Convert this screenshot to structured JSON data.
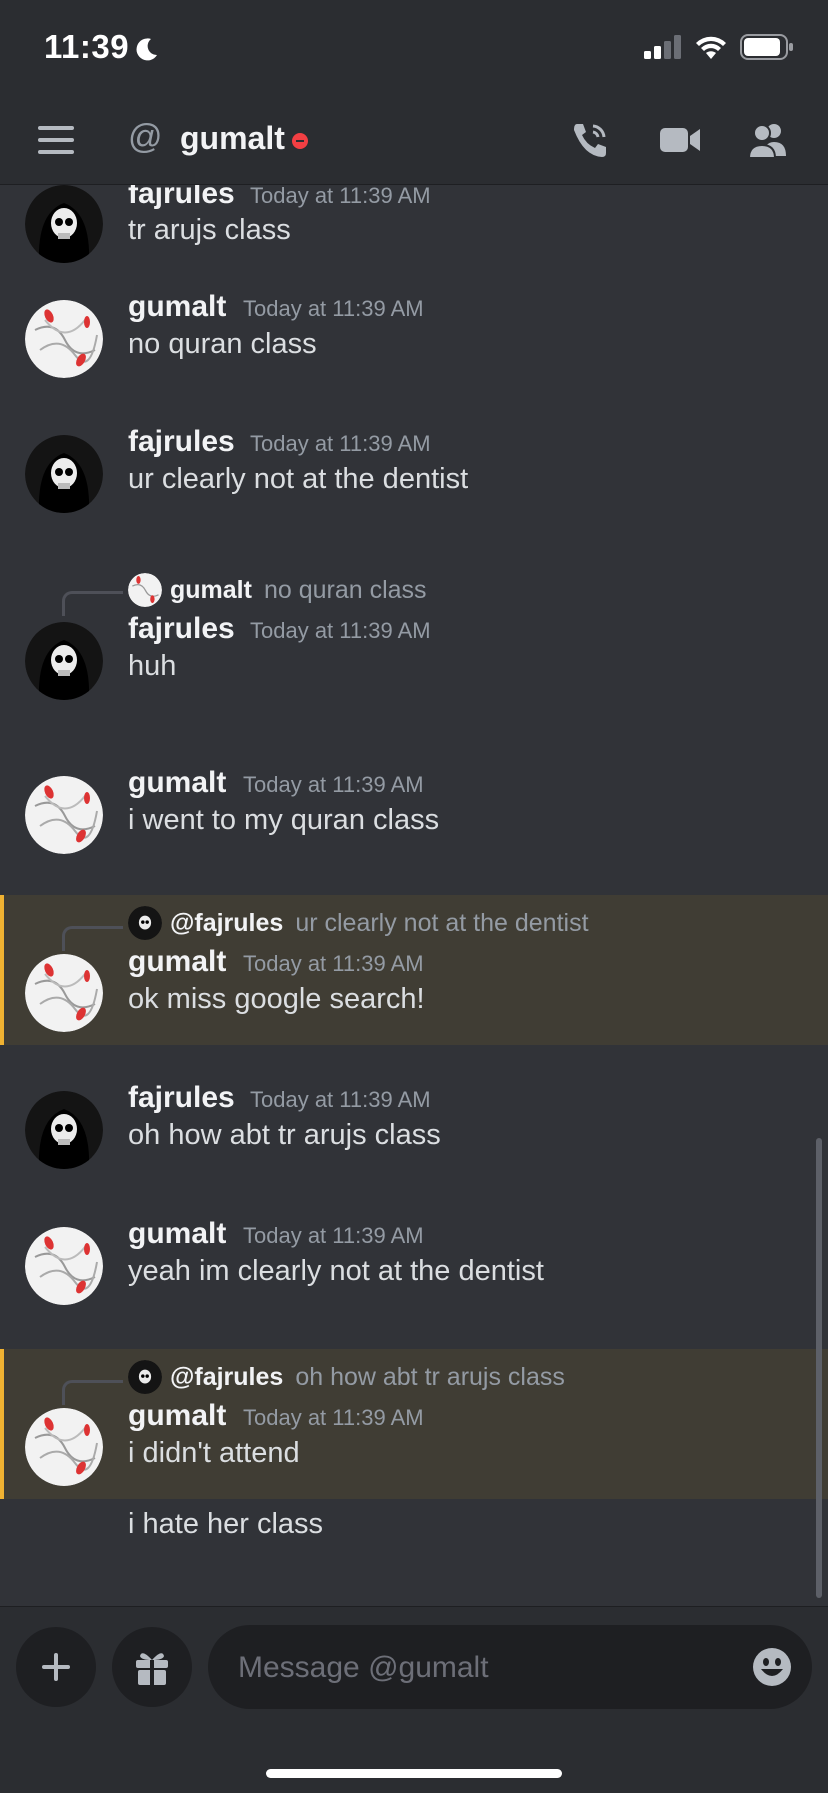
{
  "status_bar": {
    "time": "11:39"
  },
  "header": {
    "at_symbol": "@",
    "title": "gumalt"
  },
  "messages": [
    {
      "username": "fajrules",
      "timestamp": "Today at 11:39 AM",
      "lines": [
        "tr arujs class"
      ]
    },
    {
      "username": "gumalt",
      "timestamp": "Today at 11:39 AM",
      "lines": [
        "no quran class"
      ]
    },
    {
      "username": "fajrules",
      "timestamp": "Today at 11:39 AM",
      "lines": [
        "ur clearly not at the dentist"
      ]
    },
    {
      "reply_to": {
        "name": "gumalt",
        "text": "no quran class"
      },
      "username": "fajrules",
      "timestamp": "Today at 11:39 AM",
      "lines": [
        "huh"
      ]
    },
    {
      "username": "gumalt",
      "timestamp": "Today at 11:39 AM",
      "lines": [
        "i went to my quran class"
      ]
    },
    {
      "reply_to": {
        "name": "@fajrules",
        "text": "ur clearly not at the dentist"
      },
      "username": "gumalt",
      "timestamp": "Today at 11:39 AM",
      "lines": [
        "ok miss google search!"
      ]
    },
    {
      "username": "fajrules",
      "timestamp": "Today at 11:39 AM",
      "lines": [
        "oh how abt tr arujs class"
      ]
    },
    {
      "username": "gumalt",
      "timestamp": "Today at 11:39 AM",
      "lines": [
        "yeah im clearly not at the dentist"
      ]
    },
    {
      "reply_to": {
        "name": "@fajrules",
        "text": "oh how abt tr arujs class"
      },
      "username": "gumalt",
      "timestamp": "Today at 11:39 AM",
      "lines": [
        "i didn't attend",
        "i hate her class"
      ]
    }
  ],
  "composer": {
    "placeholder": "Message @gumalt"
  },
  "colors": {
    "background": "#313338",
    "header": "#2b2d31",
    "mention_highlight": "#403d34",
    "mention_bar": "#f0b232",
    "dnd": "#f23f43"
  },
  "icons": [
    "moon-icon",
    "signal-icon",
    "wifi-icon",
    "battery-icon",
    "menu-icon",
    "phone-call-icon",
    "video-camera-icon",
    "members-icon",
    "plus-icon",
    "gift-icon",
    "emoji-icon"
  ]
}
